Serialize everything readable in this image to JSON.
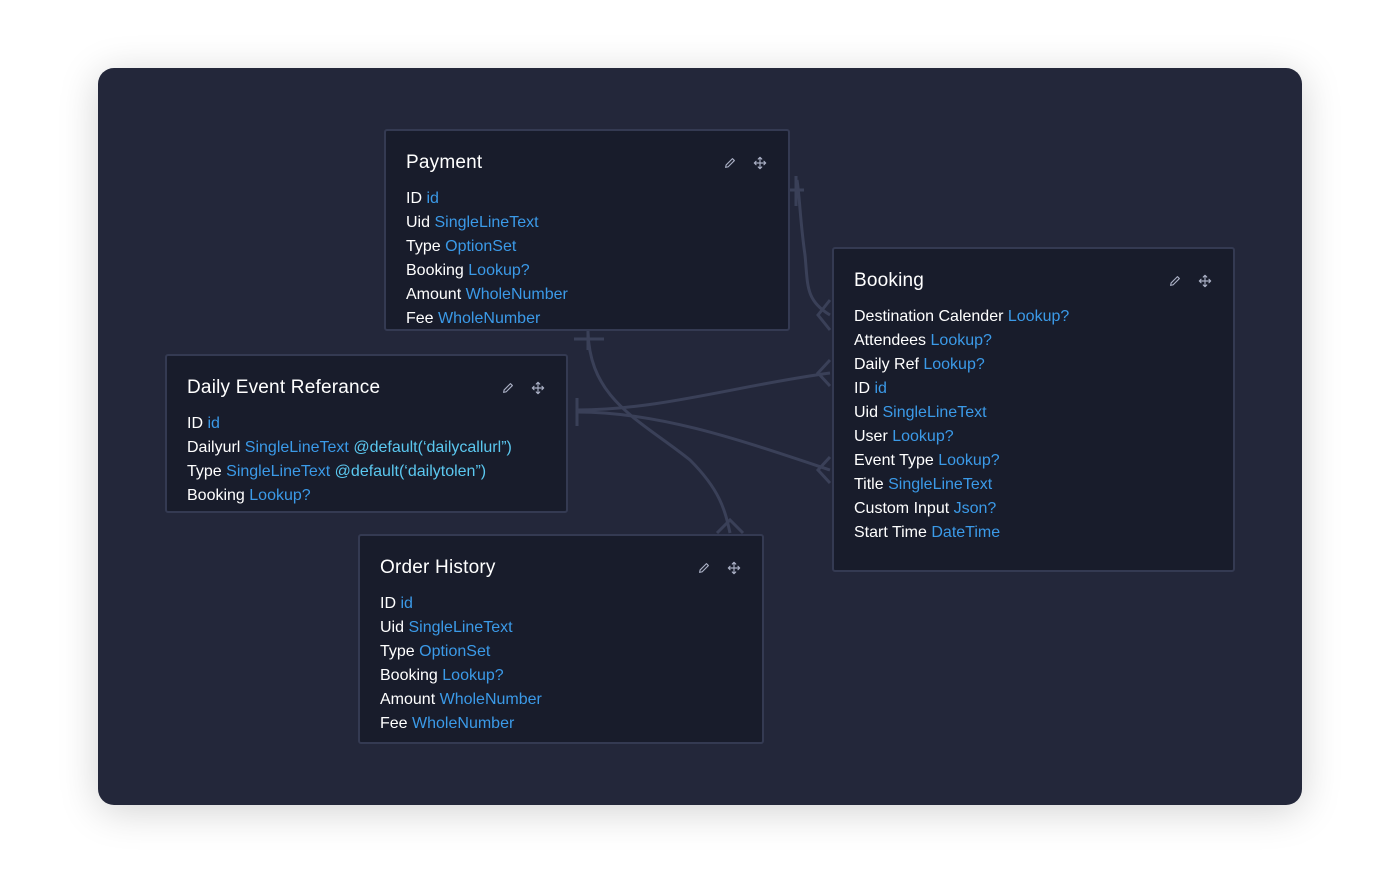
{
  "colors": {
    "canvas_bg": "#23273a",
    "card_bg": "#181c2b",
    "card_border": "#343a52",
    "connector": "#3a4058",
    "field_name": "#ffffff",
    "field_type": "#3b9ae8",
    "field_default": "#5bc8f0"
  },
  "icons": {
    "edit": "pencil-icon",
    "move": "move-arrows-icon"
  },
  "entities": {
    "payment": {
      "title": "Payment",
      "fields": [
        {
          "name": "ID",
          "type": "id"
        },
        {
          "name": "Uid",
          "type": "SingleLineText"
        },
        {
          "name": "Type",
          "type": "OptionSet"
        },
        {
          "name": "Booking",
          "type": "Lookup?"
        },
        {
          "name": "Amount",
          "type": "WholeNumber"
        },
        {
          "name": "Fee",
          "type": "WholeNumber"
        }
      ]
    },
    "booking": {
      "title": "Booking",
      "fields": [
        {
          "name": "Destination Calender",
          "type": "Lookup?"
        },
        {
          "name": "Attendees",
          "type": "Lookup?"
        },
        {
          "name": "Daily Ref",
          "type": "Lookup?"
        },
        {
          "name": "ID",
          "type": "id"
        },
        {
          "name": "Uid",
          "type": "SingleLineText"
        },
        {
          "name": "User",
          "type": "Lookup?"
        },
        {
          "name": "Event Type",
          "type": "Lookup?"
        },
        {
          "name": "Title",
          "type": "SingleLineText"
        },
        {
          "name": "Custom Input",
          "type": "Json?"
        },
        {
          "name": "Start Time",
          "type": "DateTime"
        }
      ]
    },
    "daily_event": {
      "title": "Daily Event Referance",
      "fields": [
        {
          "name": "ID",
          "type": "id",
          "default": ""
        },
        {
          "name": "Dailyurl",
          "type": "SingleLineText",
          "default": "@default(‘dailycallurl”)"
        },
        {
          "name": "Type",
          "type": "SingleLineText",
          "default": "@default(‘dailytolen”)"
        },
        {
          "name": "Booking",
          "type": "Lookup?",
          "default": ""
        }
      ]
    },
    "order_history": {
      "title": "Order History",
      "fields": [
        {
          "name": "ID",
          "type": "id"
        },
        {
          "name": "Uid",
          "type": "SingleLineText"
        },
        {
          "name": "Type",
          "type": "OptionSet"
        },
        {
          "name": "Booking",
          "type": "Lookup?"
        },
        {
          "name": "Amount",
          "type": "WholeNumber"
        },
        {
          "name": "Fee",
          "type": "WholeNumber"
        }
      ]
    }
  }
}
